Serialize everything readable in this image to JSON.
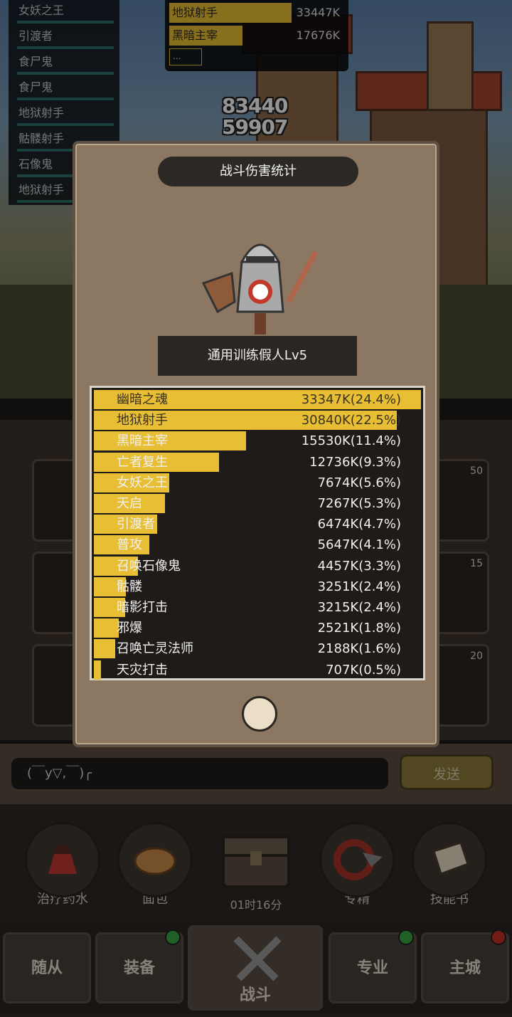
{
  "left_list": [
    "女妖之王",
    "引渡者",
    "食尸鬼",
    "食尸鬼",
    "地狱射手",
    "骷髅射手",
    "石像鬼",
    "地狱射手"
  ],
  "top_table": {
    "rows": [
      {
        "name": "地狱射手",
        "value": "33447K",
        "fill": 0.7
      },
      {
        "name": "黑暗主宰",
        "value": "17676K",
        "fill": 0.42
      }
    ],
    "more": "..."
  },
  "damage_numbers": [
    "83440",
    "59907"
  ],
  "popup": {
    "title": "战斗伤害统计",
    "target": "通用训练假人Lv5",
    "rows": [
      {
        "name": "幽暗之魂",
        "value": "33347K(24.4%)",
        "pct": 1.0
      },
      {
        "name": "地狱射手",
        "value": "30840K(22.5%)",
        "pct": 0.925
      },
      {
        "name": "黑暗主宰",
        "value": "15530K(11.4%)",
        "pct": 0.466
      },
      {
        "name": "亡者复生",
        "value": "12736K(9.3%)",
        "pct": 0.382
      },
      {
        "name": "女妖之王",
        "value": "7674K(5.6%)",
        "pct": 0.23
      },
      {
        "name": "天启",
        "value": "7267K(5.3%)",
        "pct": 0.218
      },
      {
        "name": "引渡者",
        "value": "6474K(4.7%)",
        "pct": 0.194
      },
      {
        "name": "普攻",
        "value": "5647K(4.1%)",
        "pct": 0.169
      },
      {
        "name": "召唤石像鬼",
        "value": "4457K(3.3%)",
        "pct": 0.134
      },
      {
        "name": "骷髅",
        "value": "3251K(2.4%)",
        "pct": 0.098
      },
      {
        "name": "暗影打击",
        "value": "3215K(2.4%)",
        "pct": 0.096
      },
      {
        "name": "邪爆",
        "value": "2521K(1.8%)",
        "pct": 0.076
      },
      {
        "name": "召唤亡灵法师",
        "value": "2188K(1.6%)",
        "pct": 0.066
      },
      {
        "name": "天灾打击",
        "value": "707K(0.5%)",
        "pct": 0.021
      }
    ]
  },
  "bg_cards": [
    "50",
    "15",
    "20"
  ],
  "chat": {
    "input": "(￣y▽,￣)╭",
    "send": "发送"
  },
  "items": [
    {
      "label": "治疗药水"
    },
    {
      "label": "面包"
    },
    {
      "label": "专精"
    },
    {
      "label": "技能书"
    }
  ],
  "timer": "01时16分",
  "nav": [
    "随从",
    "装备",
    "战斗",
    "专业",
    "主城"
  ],
  "colors": {
    "bar": "#e8be34",
    "panel": "#8c7862"
  }
}
